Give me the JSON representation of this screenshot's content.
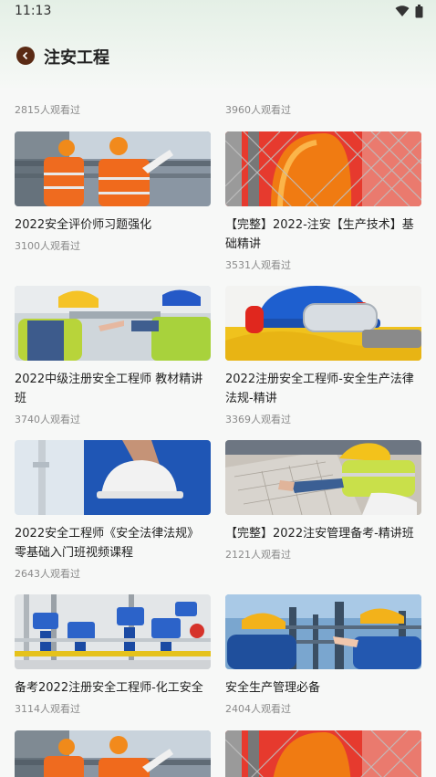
{
  "status": {
    "time": "11:13"
  },
  "header": {
    "title": "注安工程"
  },
  "top_counts": [
    "2815人观看过",
    "3960人观看过"
  ],
  "courses": [
    {
      "title": "2022安全评价师习题强化",
      "views": "3100人观看过",
      "image": "workers-vests-refinery"
    },
    {
      "title": "【完整】2022-注安【生产技术】基础精讲",
      "views": "3531人观看过",
      "image": "helmet-chainlink-fence"
    },
    {
      "title": "2022中级注册安全工程师 教材精讲班",
      "views": "3740人观看过",
      "image": "workers-hardhats-pointing"
    },
    {
      "title": "2022注册安全工程师-安全生产法律法规-精讲",
      "views": "3369人观看过",
      "image": "helmet-earmuffs-goggles"
    },
    {
      "title": "2022安全工程师《安全法律法规》零基础入门班视频课程",
      "views": "2643人观看过",
      "image": "worker-white-helmet"
    },
    {
      "title": "【完整】2022注安管理备考-精讲班",
      "views": "2121人观看过",
      "image": "engineers-blueprint"
    },
    {
      "title": "备考2022注册安全工程师-化工安全",
      "views": "3114人观看过",
      "image": "pipes-valves"
    },
    {
      "title": "安全生产管理必备",
      "views": "2404人观看过",
      "image": "workers-plant-pointing"
    },
    {
      "title": "",
      "views": "",
      "image": "workers-vests-refinery"
    },
    {
      "title": "",
      "views": "",
      "image": "helmet-chainlink-fence"
    }
  ]
}
